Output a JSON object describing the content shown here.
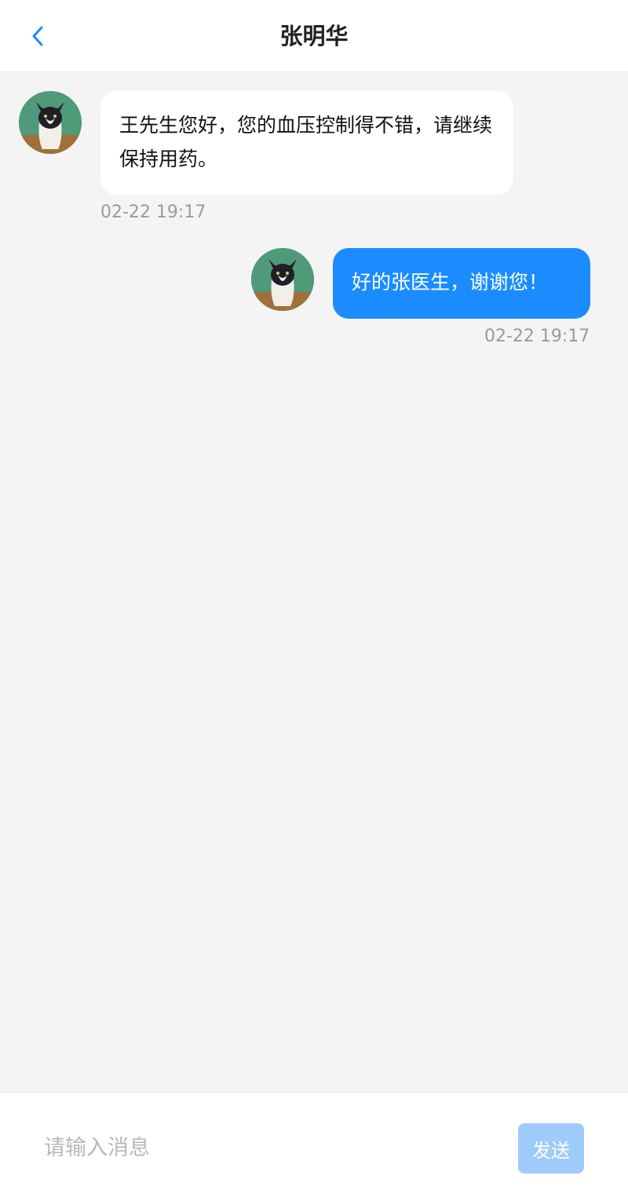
{
  "header": {
    "title": "张明华",
    "back_icon": "chevron-left-icon",
    "accent": "#1a8cff"
  },
  "messages": [
    {
      "direction": "incoming",
      "text": "王先生您好，您的血压控制得不错，请继续保持用药。",
      "time": "02-22 19:17",
      "avatar_icon": "cat-avatar"
    },
    {
      "direction": "outgoing",
      "text": "好的张医生，谢谢您！",
      "time": "02-22 19:17",
      "avatar_icon": "cat-avatar"
    }
  ],
  "composer": {
    "placeholder": "请输入消息",
    "value": "",
    "send_label": "发送"
  },
  "colors": {
    "outgoing_bubble": "#1a8cff",
    "incoming_bubble": "#ffffff",
    "send_button_disabled": "#9fcbfb",
    "background": "#f4f4f4"
  }
}
